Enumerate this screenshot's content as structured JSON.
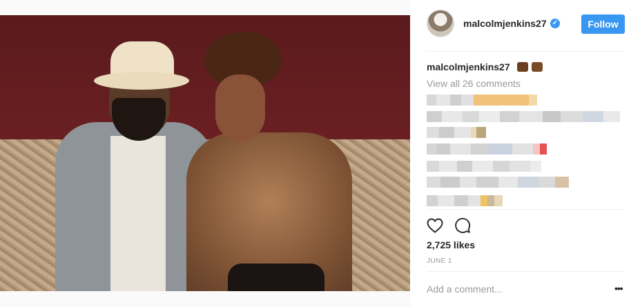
{
  "post": {
    "username": "malcolmjenkins27",
    "follow_label": "Follow",
    "caption_username": "malcolmjenkins27",
    "view_comments": "View all 26 comments",
    "likes": "2,725 likes",
    "date": "JUNE 1",
    "add_comment_placeholder": "Add a comment...",
    "more_label": "•••",
    "verified_mark": "✓"
  },
  "icons": {
    "verified": "verified-badge-icon",
    "heart": "heart-icon",
    "comment": "comment-icon",
    "more": "more-options-icon"
  },
  "colors": {
    "accent": "#3897f0",
    "text": "#262626",
    "muted": "#999999",
    "divider": "#efefef"
  }
}
